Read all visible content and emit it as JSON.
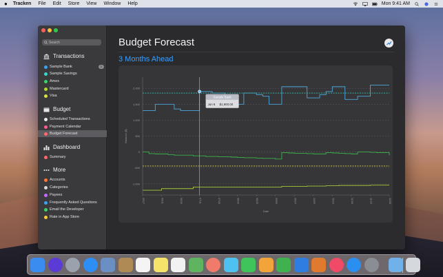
{
  "menubar": {
    "app_name": "Tracken",
    "menus": [
      "File",
      "Edit",
      "Store",
      "View",
      "Window",
      "Help"
    ],
    "clock": "Mon 9:41 AM"
  },
  "sidebar": {
    "search_placeholder": "Search",
    "sections": [
      {
        "title": "Transactions",
        "icon": "bank-icon",
        "items": [
          {
            "label": "Sample Bank",
            "color": "#3fa2ef",
            "badge": "1"
          },
          {
            "label": "Sample Savings",
            "color": "#3fd6c8"
          },
          {
            "label": "Amex",
            "color": "#3bd46a"
          },
          {
            "label": "Mastercard",
            "color": "#b4d82e"
          },
          {
            "label": "Visa",
            "color": "#d8e24a"
          }
        ]
      },
      {
        "title": "Budget",
        "icon": "calendar-icon",
        "items": [
          {
            "label": "Scheduled Transactions",
            "color": "#e9e9ec"
          },
          {
            "label": "Payment Calendar",
            "color": "#ff5d8f"
          },
          {
            "label": "Budget Forecast",
            "color": "#ff6b6b",
            "selected": true
          }
        ]
      },
      {
        "title": "Dashboard",
        "icon": "bar-chart-icon",
        "items": [
          {
            "label": "Summary",
            "color": "#ff6b6b"
          }
        ]
      },
      {
        "title": "More",
        "icon": "ellipsis-icon",
        "items": [
          {
            "label": "Accounts",
            "color": "#ff7a3d"
          },
          {
            "label": "Categories",
            "color": "#d8d8dc"
          },
          {
            "label": "Payees",
            "color": "#c46bff"
          },
          {
            "label": "Frequently Asked Questions",
            "color": "#3fa2ef"
          },
          {
            "label": "Email the Developer",
            "color": "#3bd46a"
          },
          {
            "label": "Rate in App Store",
            "color": "#ffc93c"
          }
        ]
      }
    ]
  },
  "main": {
    "title": "Budget Forecast",
    "subtitle": "3 Months Ahead"
  },
  "chart_data": {
    "type": "line",
    "xlabel": "Date",
    "ylabel": "Balance ($)",
    "x_ticks": [
      "05/27",
      "06/11",
      "06/26",
      "07/11",
      "07/26",
      "08/10",
      "08/25",
      "09/09",
      "09/24",
      "10/09",
      "10/24",
      "11/08",
      "11/23",
      "12/08"
    ],
    "y_ticks": [
      2000,
      1500,
      1000,
      500,
      0,
      -500,
      -1000
    ],
    "ylim": [
      -1350,
      2350
    ],
    "grid": "horizontal dashed",
    "tooltip": {
      "series": "Sample Bank",
      "date": "Jun 8",
      "value": "$1,900.00"
    },
    "series": [
      {
        "name": "Sample Bank",
        "color": "#4ea8de",
        "values": [
          1300,
          1300,
          1500,
          1500,
          1500,
          1350,
          1300,
          1300,
          1300,
          1900,
          1900,
          1850,
          1850,
          1500,
          1500,
          1500,
          1850,
          1850,
          1800,
          1750,
          1500,
          1500,
          2050,
          2050,
          2050,
          2050,
          1700,
          1700,
          1800,
          1900,
          2050,
          2050,
          1650,
          1650,
          1750,
          1750,
          2100,
          2100,
          2100,
          2100
        ]
      },
      {
        "name": "Sample Savings",
        "color": "#2ec4b6",
        "values": [
          1850,
          1850,
          1850,
          1850,
          1850,
          1850,
          1850,
          1850,
          1850,
          1850,
          1850,
          1850,
          1850,
          1850,
          1850,
          1850,
          1850,
          1850,
          1850,
          1850,
          1850,
          1850,
          1850,
          1850,
          1850,
          1850,
          1850,
          1850,
          1850,
          1850,
          1850,
          1850,
          1850,
          1850,
          1850,
          1850,
          1850,
          1850,
          1850,
          1850
        ]
      },
      {
        "name": "Amex",
        "color": "#3bb54a",
        "values": [
          0,
          -50,
          -60,
          -60,
          -80,
          -100,
          -100,
          -100,
          -120,
          -120,
          -140,
          -140,
          -150,
          -150,
          -160,
          -170,
          -180,
          -180,
          -190,
          -200,
          -200,
          -220,
          -20,
          -30,
          -40,
          -40,
          -50,
          -60,
          -60,
          -20,
          -30,
          -40,
          -50,
          -60,
          0,
          0,
          -10,
          -20,
          -20,
          -100
        ]
      },
      {
        "name": "Mastercard",
        "color": "#a7c93b",
        "values": [
          -1200,
          -1200,
          -1200,
          -1150,
          -1150,
          -1150,
          -1150,
          -1150,
          -1100,
          -1100,
          -1100,
          -1100,
          -1100,
          -1100,
          -1100,
          -1100,
          -1100,
          -1100,
          -1100,
          -1100,
          -1100,
          -1100,
          -1080,
          -1080,
          -1080,
          -1080,
          -1070,
          -1070,
          -1070,
          -1060,
          -1060,
          -1050,
          -1050,
          -1050,
          -1050,
          -1050,
          -1040,
          -1040,
          -1040,
          -1040
        ]
      },
      {
        "name": "Visa",
        "color": "#e1d54c",
        "values": [
          -440,
          -440,
          -440,
          -440,
          -440,
          -440,
          -440,
          -440,
          -440,
          -440,
          -440,
          -440,
          -440,
          -440,
          -440,
          -440,
          -440,
          -440,
          -440,
          -440,
          -440,
          -440,
          -440,
          -440,
          -440,
          -440,
          -440,
          -440,
          -440,
          -440,
          -440,
          -440,
          -440,
          -440,
          -440,
          -440,
          -440,
          -440,
          -440,
          -440
        ]
      }
    ]
  },
  "dock": {
    "apps": [
      {
        "name": "finder-icon",
        "color": "#3b8cf0"
      },
      {
        "name": "siri-icon",
        "color": "#5b3ad6"
      },
      {
        "name": "launchpad-icon",
        "color": "#9aa2ad"
      },
      {
        "name": "safari-icon",
        "color": "#2d8ef5"
      },
      {
        "name": "photo-preview-icon",
        "color": "#6a8fc2"
      },
      {
        "name": "contacts-icon",
        "color": "#b08a55"
      },
      {
        "name": "calendar-icon",
        "color": "#f4f4f4"
      },
      {
        "name": "notes-icon",
        "color": "#f6e36a"
      },
      {
        "name": "reminders-icon",
        "color": "#f2f2f2"
      },
      {
        "name": "maps-icon",
        "color": "#5fb55f"
      },
      {
        "name": "photos-icon",
        "color": "#f07b6a"
      },
      {
        "name": "messages-icon",
        "color": "#4fc1f0"
      },
      {
        "name": "facetime-icon",
        "color": "#3ec45a"
      },
      {
        "name": "pages-icon",
        "color": "#f2a33a"
      },
      {
        "name": "numbers-icon",
        "color": "#3fb24f"
      },
      {
        "name": "keynote-icon",
        "color": "#2f7de0"
      },
      {
        "name": "tracken-icon",
        "color": "#e07a2f"
      },
      {
        "name": "music-icon",
        "color": "#f04a67"
      },
      {
        "name": "app-store-icon",
        "color": "#2a8ff0"
      },
      {
        "name": "system-preferences-icon",
        "color": "#8a8e94"
      },
      {
        "name": "downloads-folder-icon",
        "color": "#6fb1e8"
      },
      {
        "name": "trash-icon",
        "color": "#d5d8dc"
      }
    ]
  }
}
